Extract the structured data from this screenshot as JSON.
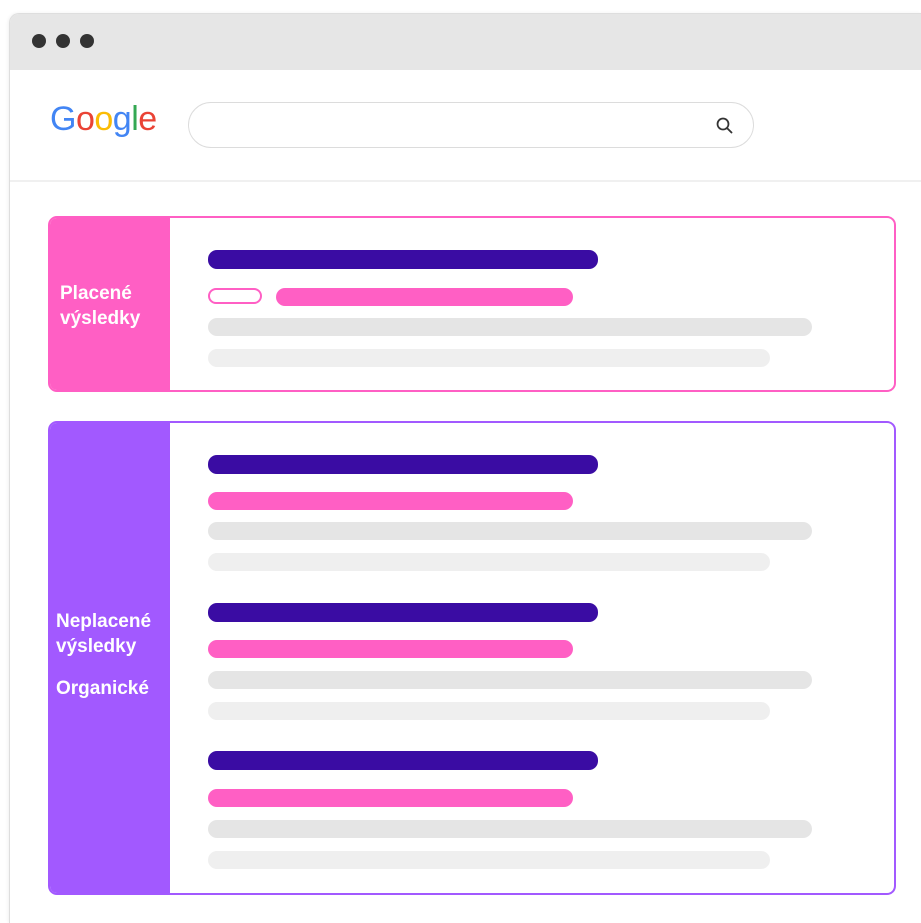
{
  "browser": {
    "window_dots": 3
  },
  "search": {
    "logo_letters": [
      "G",
      "o",
      "o",
      "g",
      "l",
      "e"
    ],
    "logo_colors": [
      "#4285F4",
      "#EA4335",
      "#FBBC05",
      "#4285F4",
      "#34A853",
      "#EA4335"
    ],
    "value": "",
    "icon": "search-icon"
  },
  "paid": {
    "label_line1": "Placené",
    "label_line2": "výsledky",
    "color": "#ff5fc4"
  },
  "organic": {
    "label_line1": "Neplacené",
    "label_line2": "výsledky",
    "label_line3": "Organické",
    "color": "#a259ff"
  },
  "colors": {
    "title_bar": "#3a0ca3",
    "url_bar": "#ff5fc4",
    "snippet": "#e5e5e5"
  }
}
